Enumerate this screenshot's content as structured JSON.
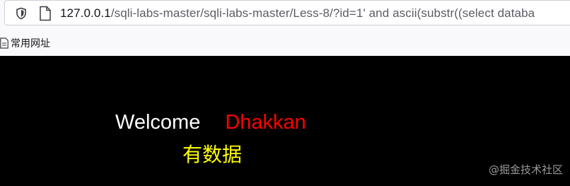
{
  "browser": {
    "url_host": "127.0.0.1",
    "url_path": "/sqli-labs-master/sqli-labs-master/Less-8/?id=1' and ascii(substr((select databa",
    "bookmarks": [
      {
        "label": "常用网址",
        "icon": "folder-icon"
      }
    ]
  },
  "page": {
    "welcome": "Welcome",
    "name": "Dhakkan",
    "result": "有数据",
    "watermark": "@掘金技术社区"
  },
  "colors": {
    "background": "#000000",
    "welcome": "#ffffff",
    "name": "#ff0000",
    "result": "#ffff00"
  }
}
